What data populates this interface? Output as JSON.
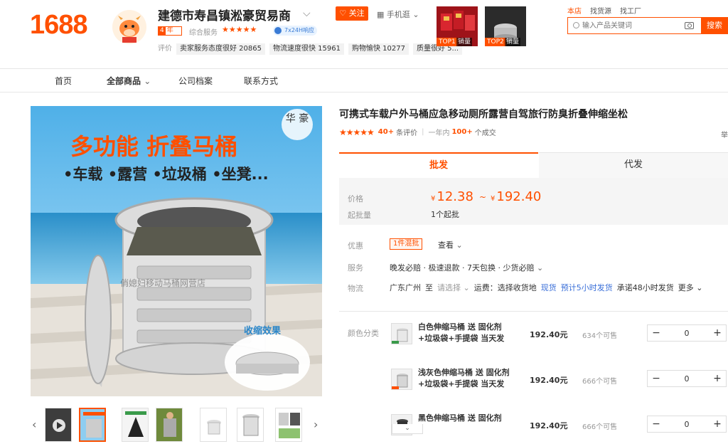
{
  "header": {
    "logo_text": "1688",
    "shop_name": "建德市寿昌镇淞豪贸易商",
    "follow_label": "关注",
    "mobile_label": "手机逛",
    "years_badge_num": "4",
    "years_badge_text": "年",
    "service_label": "综合服务",
    "service_stars": "★★★★★",
    "badge_24h": "7x24H响应",
    "eval_label": "评价",
    "eval_chips": [
      "卖家服务态度很好 20865",
      "物流速度很快 15961",
      "购物愉快 10277",
      "质量很好 5..."
    ],
    "top_products": [
      {
        "tag": "TOP1",
        "tag2": "销量"
      },
      {
        "tag": "TOP2",
        "tag2": "销量"
      }
    ],
    "search_tabs": [
      "本店",
      "找货源",
      "找工厂"
    ],
    "search_placeholder": "输入产品关键词",
    "search_button": "搜索"
  },
  "nav": {
    "items": [
      "首页",
      "全部商品",
      "公司档案",
      "联系方式"
    ]
  },
  "gallery": {
    "headline": "多功能 折叠马桶",
    "subline": "•车载 •露营 •垃圾桶 •坐凳...",
    "seal_text": "华 豪",
    "badge": "收缩效果",
    "watermark": "俏媳妇移动马桶网营店"
  },
  "product": {
    "title": "可携式车载户外马桶应急移动厕所露营自驾旅行防臭折叠伸缩坐松",
    "rating_stars": "★★★★★",
    "review_count": "40+",
    "review_suffix": "条评价",
    "yearly_prefix": "一年内",
    "yearly_count": "100+",
    "yearly_suffix": "个成交",
    "side_char": "举"
  },
  "tabs": {
    "wholesale": "批发",
    "dropship": "代发"
  },
  "pricing": {
    "price_label": "价格",
    "currency": "¥",
    "price_low": "12.38",
    "price_sep": "~",
    "price_high": "192.40",
    "moq_label": "起批量",
    "moq_value": "1个起批"
  },
  "info": {
    "promo_label": "优惠",
    "promo_tag": "1件混批",
    "promo_view": "查看",
    "service_label": "服务",
    "service_text": "晚发必赔 · 极速退款 · 7天包换 · 少货必赔",
    "logistics_label": "物流",
    "logistics_from": "广东广州",
    "logistics_to": "至",
    "logistics_select": "请选择",
    "logistics_fee": "运费：选择收货地",
    "logistics_stock": "现货",
    "logistics_ship": "预计5小时发货",
    "logistics_promise": "承诺48小时发货",
    "logistics_more": "更多"
  },
  "sku": {
    "label": "颜色分类",
    "rows": [
      {
        "name": "白色伸缩马桶 送 固化剂+垃圾袋+手提袋 当天发",
        "price": "192.40元",
        "stock": "634个可售",
        "qty": "0"
      },
      {
        "name": "浅灰色伸缩马桶 送 固化剂+垃圾袋+手提袋 当天发",
        "price": "192.40元",
        "stock": "666个可售",
        "qty": "0"
      },
      {
        "name": "黑色伸缩马桶 送 固化剂",
        "price": "192.40元",
        "stock": "666个可售",
        "qty": "0"
      }
    ]
  },
  "colors": {
    "accent": "#ff5000",
    "link": "#3a6fd8"
  }
}
